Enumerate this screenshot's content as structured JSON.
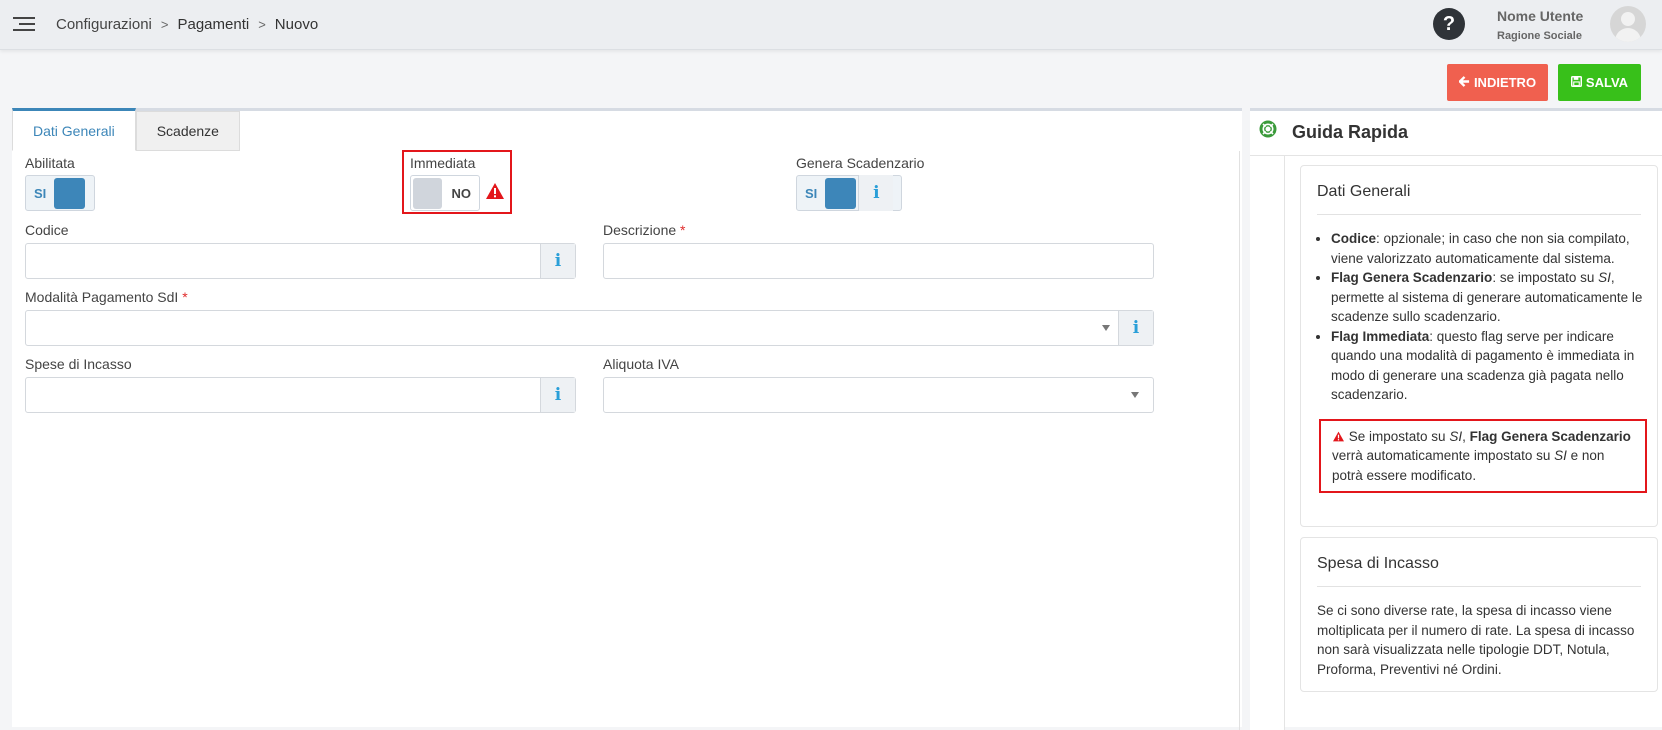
{
  "topbar": {
    "breadcrumb": [
      "Configurazioni",
      "Pagamenti",
      "Nuovo"
    ],
    "separator": ">",
    "help_label": "?",
    "user_name": "Nome Utente",
    "user_company": "Ragione Sociale"
  },
  "actions": {
    "back_label": "INDIETRO",
    "save_label": "SALVA",
    "back_color": "#f0604f",
    "save_color": "#38c01a"
  },
  "tabs": [
    {
      "label": "Dati Generali",
      "active": true
    },
    {
      "label": "Scadenze",
      "active": false
    }
  ],
  "form": {
    "abilitata": {
      "label": "Abilitata",
      "value": "SI"
    },
    "immediata": {
      "label": "Immediata",
      "value": "NO"
    },
    "genera_scadenzario": {
      "label": "Genera Scadenzario",
      "value": "SI"
    },
    "codice": {
      "label": "Codice",
      "value": ""
    },
    "descrizione": {
      "label": "Descrizione",
      "required_mark": "*",
      "value": ""
    },
    "modalita": {
      "label": "Modalità Pagamento SdI",
      "required_mark": "*",
      "value": ""
    },
    "spese_incasso": {
      "label": "Spese di Incasso",
      "value": ""
    },
    "aliquota_iva": {
      "label": "Aliquota IVA",
      "value": ""
    },
    "info_glyph": "i"
  },
  "guide": {
    "title": "Guida Rapida",
    "cards": [
      {
        "title": "Dati Generali",
        "items": [
          {
            "bold": "Codice",
            "text": ": opzionale; in caso che non sia compilato, viene valorizzato automaticamente dal sistema."
          },
          {
            "bold": "Flag Genera Scadenzario",
            "text_before": ": se impostato su ",
            "italic": "SI",
            "text_after": ", permette al sistema di generare automaticamente le scadenze sullo scadenzario."
          },
          {
            "bold": "Flag Immediata",
            "text": ": questo flag serve per indicare quando una modalità di pagamento è immediata in modo di generare una scadenza già pagata nello scadenzario."
          }
        ],
        "warning": {
          "t1": " Se impostato su ",
          "i1": "SI",
          "t2": ", ",
          "b1": "Flag Genera Scadenzario",
          "t3": " verrà automaticamente impostato su ",
          "i2": "SI",
          "t4": " e non potrà essere modificato."
        }
      },
      {
        "title": "Spesa di Incasso",
        "text": "Se ci sono diverse rate, la spesa di incasso viene moltiplicata per il numero di rate. La spesa di incasso non sarà visualizzata nelle tipologie DDT, Notula, Proforma, Preventivi né Ordini."
      }
    ]
  },
  "colors": {
    "accent": "#3c86b8",
    "info_icon": "#2a9fd8",
    "warning_red": "#e3161b"
  }
}
